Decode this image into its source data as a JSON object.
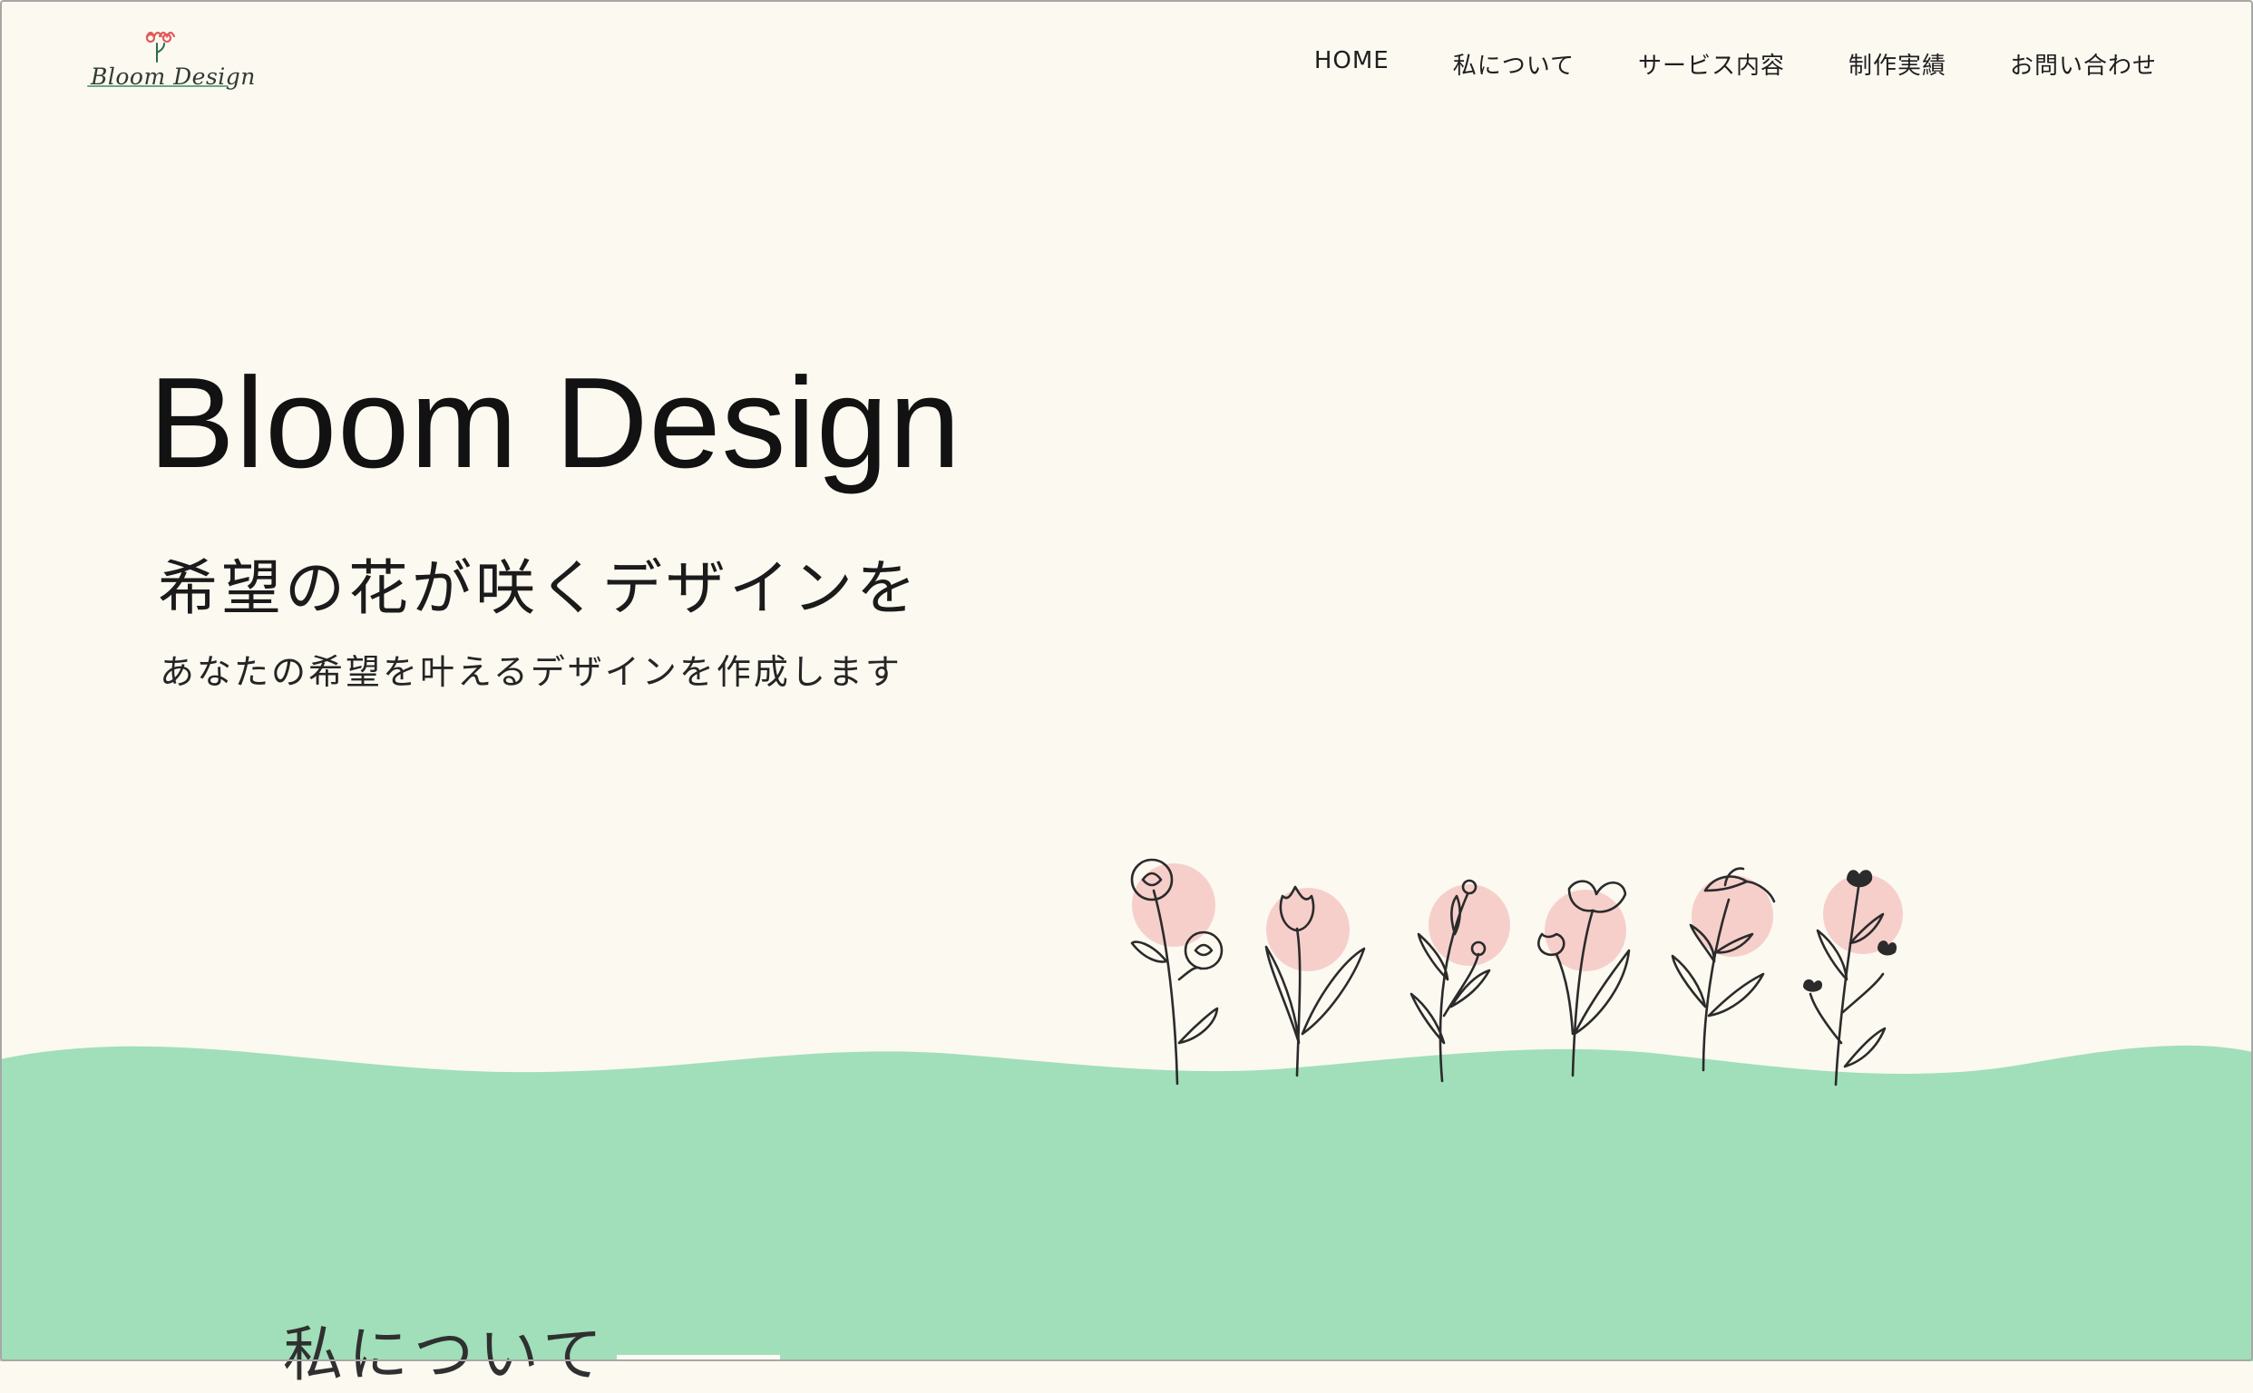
{
  "brand": {
    "logo_text": "Bloom Design",
    "accent_green": "#a0dfb9",
    "accent_pink": "#f6cfcb"
  },
  "nav": {
    "items": [
      "HOME",
      "私について",
      "サービス内容",
      "制作実績",
      "お問い合わせ"
    ]
  },
  "hero": {
    "title": "Bloom Design",
    "subtitle": "希望の花が咲くデザインを",
    "description": "あなたの希望を叶えるデザインを作成します"
  },
  "about": {
    "heading": "私について"
  },
  "decor": {
    "flowers": [
      "rose",
      "tulip",
      "bud-branch",
      "lily",
      "daisy",
      "leaf-sprig"
    ]
  }
}
